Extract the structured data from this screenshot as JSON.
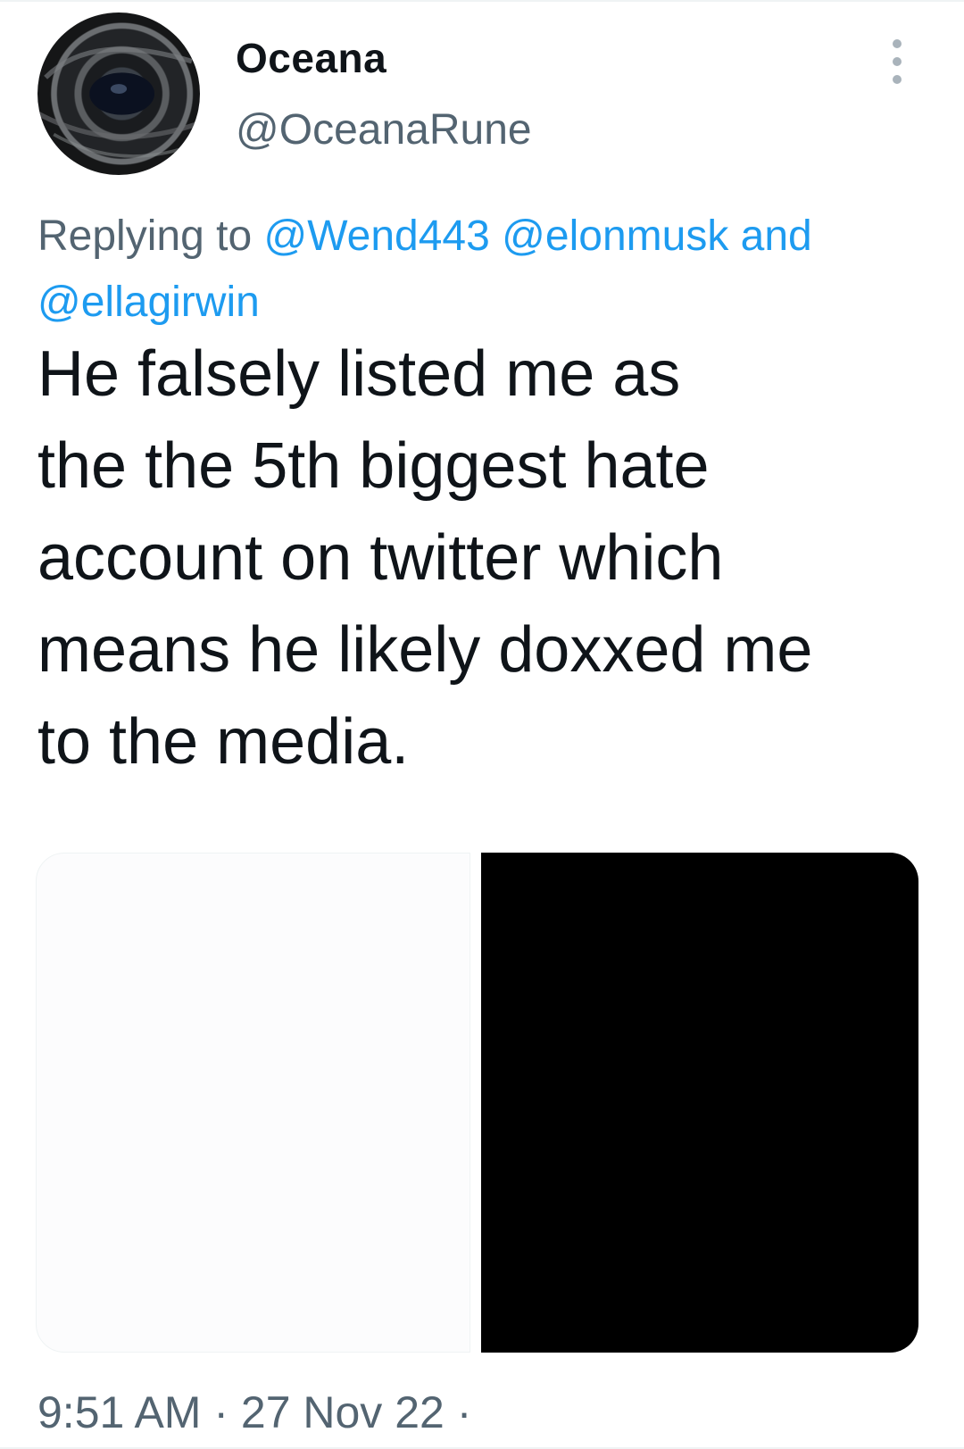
{
  "author": {
    "display_name": "Oceana",
    "handle": "@OceanaRune"
  },
  "reply": {
    "prefix": "Replying to ",
    "mention_1": "@Wend443",
    "mention_2": "@elonmusk",
    "conjunction": " and",
    "mention_3": "@ellagirwin"
  },
  "tweet": {
    "lines": [
      "He falsely listed me as",
      "the the 5th biggest hate",
      "account on twitter which",
      "means he likely doxxed me",
      "to the media."
    ]
  },
  "meta": {
    "timestamp": "9:51 AM · 27 Nov 22 ·"
  },
  "icons": {
    "more": "more-options-icon",
    "avatar": "whale-eye-avatar"
  },
  "colors": {
    "text": "#0f1419",
    "secondary": "#536471",
    "link": "#1d9bf0"
  }
}
